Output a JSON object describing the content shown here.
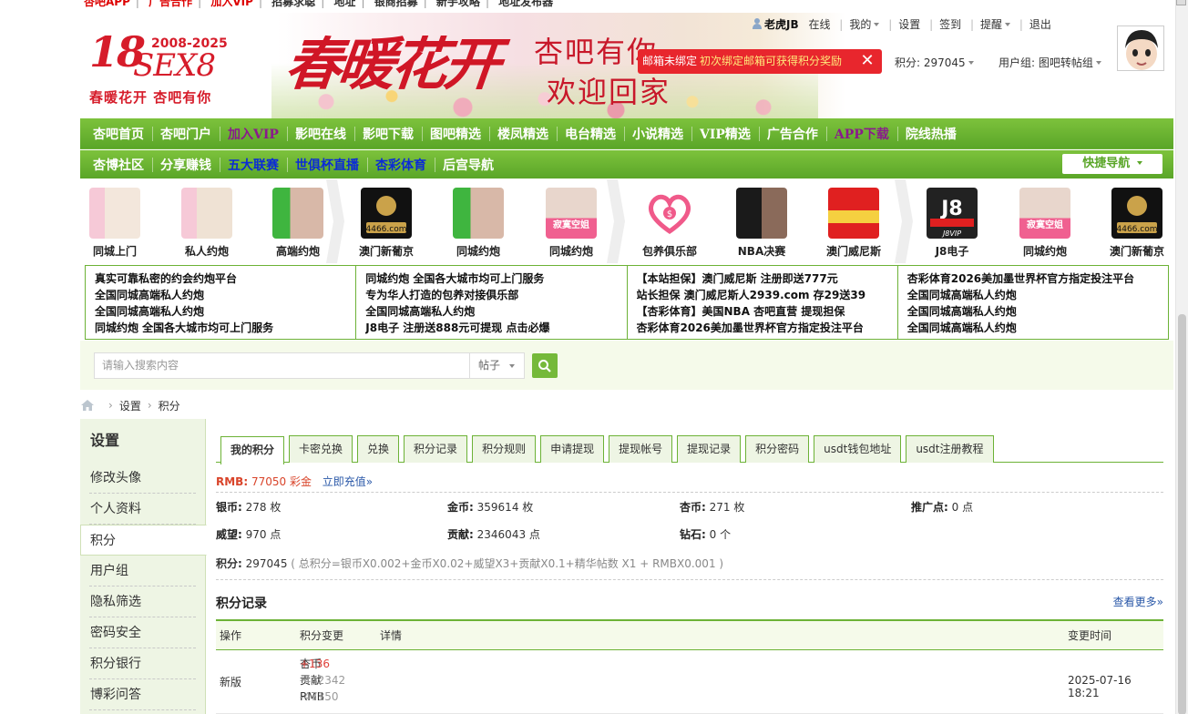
{
  "toplinks": [
    "杏吧APP",
    "广告合作",
    "加入VIP",
    "招募求聪",
    "地址",
    "银商招募",
    "新手攻略",
    "地址发布器"
  ],
  "header": {
    "logo_main": "18",
    "logo_sex": "SEX8",
    "logo_years": "2008-2025",
    "logo_slogan": "春暖花开 杏吧有你",
    "banner_big": "春暖花开",
    "banner_sub1": "杏吧有你",
    "banner_sub2": "欢迎回家"
  },
  "user": {
    "name": "老虎JB",
    "online": "在线",
    "mine": "我的",
    "settings": "设置",
    "signin": "签到",
    "remind": "提醒",
    "logout": "退出",
    "credits_label": "积分: 297045",
    "group_label": "用户组: 图吧转帖组",
    "email_alert": "邮箱未绑定",
    "email_hint": "初次绑定邮箱可获得积分奖励"
  },
  "nav1": [
    "杏吧首页",
    "杏吧门户",
    "加入VIP",
    "影吧在线",
    "影吧下载",
    "图吧精选",
    "楼凤精选",
    "电台精选",
    "小说精选",
    "VIP精选",
    "广告合作",
    "APP下载",
    "院线热播"
  ],
  "nav2": [
    "杏博社区",
    "分享赚钱",
    "五大联赛",
    "世俱杯直播",
    "杏彩体育",
    "后宫导航"
  ],
  "quick_nav": "快捷导航",
  "ads": [
    "同城上门",
    "私人约炮",
    "高端约炮",
    "澳门新葡京",
    "同城约炮",
    "同城约炮",
    "包养俱乐部",
    "NBA决赛",
    "澳门威尼斯",
    "J8电子",
    "同城约炮",
    "澳门新葡京"
  ],
  "ad_thumb_text": {
    "gold_logo": "4466.com",
    "j8": "J8",
    "j8_sub": "J8VIP",
    "promo": "寂寞空姐"
  },
  "text_ads": [
    [
      "真实可靠私密的约会约炮平台",
      "全国同城高端私人约炮",
      "全国同城高端私人约炮",
      "同城约炮 全国各大城市均可上门服务"
    ],
    [
      "同城约炮 全国各大城市均可上门服务",
      "专为华人打造的包养对接俱乐部",
      "全国同城高端私人约炮",
      "J8电子 注册送888元可提现 点击必爆"
    ],
    [
      "【本站担保】澳门威尼斯 注册即送777元",
      "站长担保 澳门威尼斯人2939.com 存29送39",
      "【杏彩体育】美国NBA 杏吧直营 提现担保",
      "杏彩体育2026美加墨世界杯官方指定投注平台"
    ],
    [
      "杏彩体育2026美加墨世界杯官方指定投注平台",
      "全国同城高端私人约炮",
      "全国同城高端私人约炮",
      "全国同城高端私人约炮"
    ]
  ],
  "search": {
    "placeholder": "请输入搜索内容",
    "type": "帖子"
  },
  "breadcrumb": [
    "设置",
    "积分"
  ],
  "sidebar": {
    "title": "设置",
    "items": [
      "修改头像",
      "个人资料",
      "积分",
      "用户组",
      "隐私筛选",
      "密码安全",
      "积分银行",
      "博彩问答"
    ]
  },
  "tabs": [
    "我的积分",
    "卡密兑换",
    "兑换",
    "积分记录",
    "积分规则",
    "申请提现",
    "提现帐号",
    "提现记录",
    "积分密码",
    "usdt钱包地址",
    "usdt注册教程"
  ],
  "rmb": {
    "label": "RMB:",
    "value": "77050 彩金",
    "topup": "立即充值»"
  },
  "stats": {
    "yinbi_label": "银币:",
    "yinbi": "278 枚",
    "jinbi_label": "金币:",
    "jinbi": "359614 枚",
    "xingbi_label": "杏币:",
    "xingbi": "271 枚",
    "tuiguang_label": "推广点:",
    "tuiguang": "0 点",
    "weiwang_label": "威望:",
    "weiwang": "970 点",
    "gongxian_label": "贡献:",
    "gongxian": "2346043 点",
    "zuanshi_label": "钻石:",
    "zuanshi": "0 个"
  },
  "total": {
    "label": "积分:",
    "value": "297045",
    "formula": "( 总积分=银币X0.002+金币X0.02+威望X3+贡献X0.1+精华帖数 X1 + RMBX0.001 )"
  },
  "records": {
    "title": "积分记录",
    "more": "查看更多»",
    "headers": [
      "操作",
      "积分变更",
      "详情",
      "变更时间"
    ],
    "rows": [
      {
        "action": "新版",
        "changes": [
          {
            "name": "杏币",
            "delta": "+136"
          },
          {
            "name": "贡献",
            "delta": "-442342"
          },
          {
            "name": "RMB",
            "delta": "-47150"
          }
        ],
        "time": "2025-07-16 18:21"
      }
    ]
  },
  "colors": {
    "green": "#6cb236",
    "red": "#e8262d",
    "link": "#2a58a8"
  }
}
